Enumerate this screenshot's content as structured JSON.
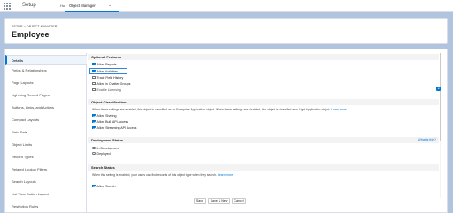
{
  "app": {
    "name": "Setup"
  },
  "nav_tabs": {
    "home": "Home",
    "object_manager": "Object Manager"
  },
  "header": {
    "breadcrumb": "SETUP > OBJECT MANAGER",
    "title": "Employee"
  },
  "sidebar": {
    "items": [
      "Details",
      "Fields & Relationships",
      "Page Layouts",
      "Lightning Record Pages",
      "Buttons, Links, and Actions",
      "Compact Layouts",
      "Field Sets",
      "Object Limits",
      "Record Types",
      "Related Lookup Filters",
      "Search Layouts",
      "List View Button Layout",
      "Restriction Rules"
    ]
  },
  "optional_features": {
    "heading": "Optional Features",
    "options": [
      {
        "label": "Allow Reports",
        "checked": true
      },
      {
        "label": "Allow Activities",
        "checked": true
      },
      {
        "label": "Track Field History",
        "checked": false
      },
      {
        "label": "Allow in Chatter Groups",
        "checked": false
      },
      {
        "label": "Enable Licensing",
        "checked": false
      }
    ]
  },
  "object_classification": {
    "heading": "Object Classification",
    "description": "When these settings are enabled, this object is classified as an Enterprise Application object. When these settings are disabled, this object is classified as a Light Application object.",
    "learn_more": "Learn more",
    "options": [
      {
        "label": "Allow Sharing",
        "checked": true
      },
      {
        "label": "Allow Bulk API Access",
        "checked": true
      },
      {
        "label": "Allow Streaming API Access",
        "checked": true
      }
    ]
  },
  "deployment_status": {
    "heading": "Deployment Status",
    "help": "What is this?",
    "options": [
      {
        "label": "In Development",
        "selected": false
      },
      {
        "label": "Deployed",
        "selected": true
      }
    ]
  },
  "search_status": {
    "heading": "Search Status",
    "description": "When this setting is enabled, your users can find records of this object type when they search.",
    "learn_more": "Learn more",
    "options": [
      {
        "label": "Allow Search",
        "checked": true
      }
    ]
  },
  "buttons": {
    "save": "Save",
    "save_new": "Save & New",
    "cancel": "Cancel"
  },
  "colors": {
    "accent": "#0176d3",
    "background": "#b0c4df"
  }
}
